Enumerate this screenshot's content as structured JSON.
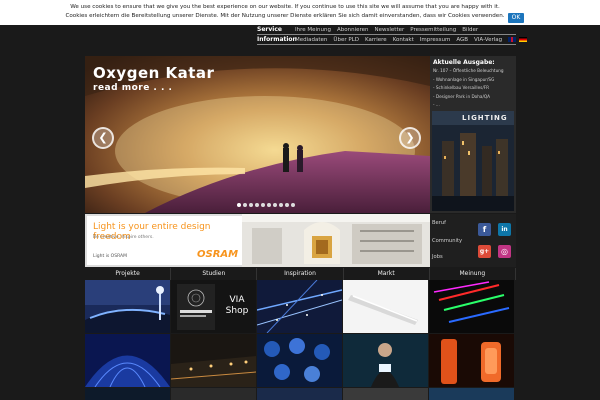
{
  "cookie": {
    "text_line1": "We use cookies to ensure that we give you the best experience on our website. If you continue to use this site we will assume that you are happy with it.",
    "text_line2": "Cookies erleichtern die Bereitstellung unserer Dienste. Mit der Nutzung unserer Dienste erklären Sie sich damit einverstanden, dass wir Cookies verwenden.",
    "ok_label": "OK"
  },
  "nav": {
    "service": {
      "label": "Service",
      "items": [
        "Ihre Meinung",
        "Abonnieren",
        "Newsletter",
        "Pressemitteilung",
        "Bilder"
      ]
    },
    "information": {
      "label": "Information",
      "items": [
        "Mediadaten",
        "Über PLD",
        "Karriere",
        "Kontakt",
        "Impressum",
        "AGB",
        "VIA-Verlag"
      ]
    }
  },
  "slider": {
    "title": "Oxygen Katar",
    "more": "read more . . .",
    "prev": "❮",
    "next": "❯"
  },
  "issue": {
    "title": "Aktuelle Ausgabe:",
    "lines": [
      "Nr. 107 – Öffentliche Beleuchtung",
      "- Wohnanlage in Singapur/SG",
      "- Schinkelbau Versailles/FR",
      "- Designer Park in Doha/QA",
      "- ..."
    ],
    "cover_logo": "LIGHTING"
  },
  "banner": {
    "headline": "Light is your entire design freedom",
    "sub": "Be creative. Inspire others.",
    "bottom": "Light is OSRAM",
    "brand": "OSRAM"
  },
  "social": {
    "links": [
      "Beruf",
      "Community",
      "Jobs"
    ],
    "icons": {
      "facebook": "f",
      "linkedin": "in",
      "googleplus": "g+",
      "instagram": "◎"
    }
  },
  "tabs": [
    "Projekte",
    "Studien",
    "Inspiration",
    "Markt",
    "Meinung"
  ],
  "tiles": {
    "via_shop": "VIA Shop"
  },
  "colors": {
    "ok_blue": "#1c75bc",
    "osram_orange": "#f7941d",
    "background": "#1a1a1a"
  }
}
